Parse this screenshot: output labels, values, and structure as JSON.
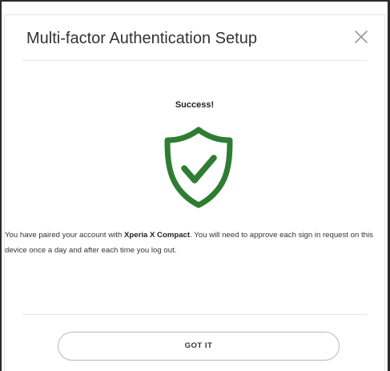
{
  "dialog": {
    "title": "Multi-factor Authentication Setup",
    "close_icon": "close-icon"
  },
  "success": {
    "heading": "Success!",
    "icon": "shield-check-icon",
    "icon_color": "#2e7d32"
  },
  "message": {
    "before": "You have paired your account with ",
    "device": "Xperia X Compact",
    "after": ". You will need to approve each sign in request on this device once a day and after each time you log out."
  },
  "footer": {
    "button_label": "GOT IT"
  }
}
